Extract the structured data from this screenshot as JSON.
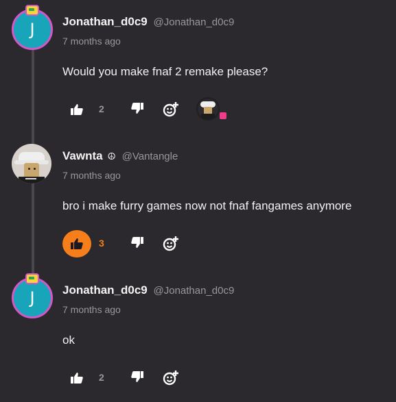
{
  "comments": [
    {
      "avatar_letter": "J",
      "username": "Jonathan_d0c9",
      "handle": "@Jonathan_d0c9",
      "time": "7 months ago",
      "text": "Would you make fnaf 2 remake please?",
      "likes": "2",
      "liked": false
    },
    {
      "username": "Vawnta",
      "badge": "☮",
      "handle": "@Vantangle",
      "time": "7 months ago",
      "text": "bro i make furry games now not fnaf fangames anymore",
      "likes": "3",
      "liked": true
    },
    {
      "avatar_letter": "J",
      "username": "Jonathan_d0c9",
      "handle": "@Jonathan_d0c9",
      "time": "7 months ago",
      "text": "ok",
      "likes": "2",
      "liked": false
    }
  ],
  "colors": {
    "background": "#2b292d",
    "accent_orange": "#f77f1b",
    "avatar_teal": "#19a5b9",
    "avatar_ring": "#d457c8",
    "muted_text": "#9a979d"
  },
  "icons": [
    "thumbs-up-icon",
    "thumbs-down-icon",
    "add-reaction-icon"
  ]
}
